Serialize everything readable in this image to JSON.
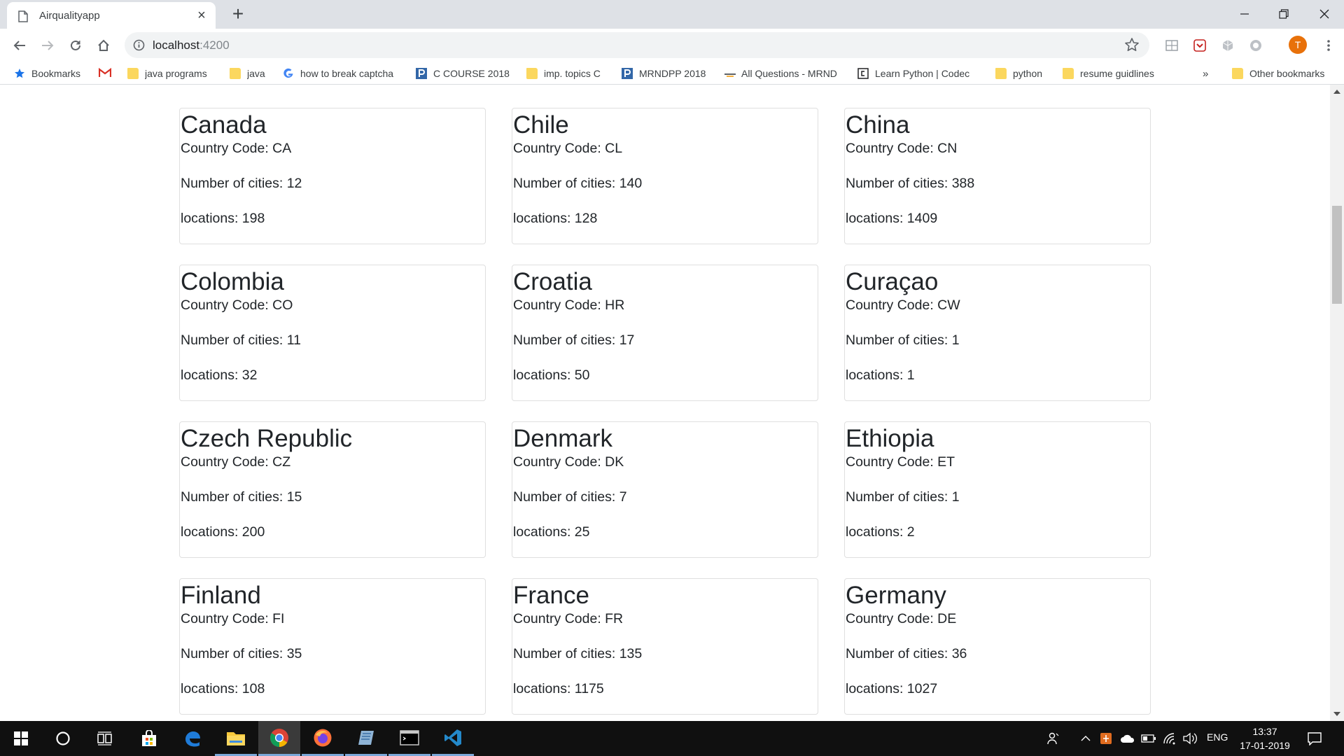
{
  "browser": {
    "tab_title": "Airqualityapp",
    "url_host": "localhost",
    "url_port": ":4200",
    "avatar_initial": "T",
    "accent_color": "#e8710a"
  },
  "bookmarks": {
    "items": [
      {
        "label": "Bookmarks",
        "icon": "star-icon"
      },
      {
        "label": "",
        "icon": "gmail-icon"
      },
      {
        "label": "java programs",
        "icon": "folder-icon"
      },
      {
        "label": "java",
        "icon": "folder-icon"
      },
      {
        "label": "how to break captcha",
        "icon": "google-icon"
      },
      {
        "label": "C COURSE 2018",
        "icon": "p-icon"
      },
      {
        "label": "imp. topics C",
        "icon": "folder-icon"
      },
      {
        "label": "MRNDPP 2018",
        "icon": "p-icon"
      },
      {
        "label": "All Questions - MRND",
        "icon": "dash-icon"
      },
      {
        "label": "Learn Python | Codec",
        "icon": "codec-icon"
      },
      {
        "label": "python",
        "icon": "folder-icon"
      },
      {
        "label": "resume guidlines",
        "icon": "folder-icon"
      }
    ],
    "overflow": "»",
    "other": "Other bookmarks"
  },
  "countries": [
    {
      "name": "Canada",
      "code": "Country Code: CA",
      "cities": "Number of cities: 12",
      "locations": "locations: 198"
    },
    {
      "name": "Chile",
      "code": "Country Code: CL",
      "cities": "Number of cities: 140",
      "locations": "locations: 128"
    },
    {
      "name": "China",
      "code": "Country Code: CN",
      "cities": "Number of cities: 388",
      "locations": "locations: 1409"
    },
    {
      "name": "Colombia",
      "code": "Country Code: CO",
      "cities": "Number of cities: 11",
      "locations": "locations: 32"
    },
    {
      "name": "Croatia",
      "code": "Country Code: HR",
      "cities": "Number of cities: 17",
      "locations": "locations: 50"
    },
    {
      "name": "Curaçao",
      "code": "Country Code: CW",
      "cities": "Number of cities: 1",
      "locations": "locations: 1"
    },
    {
      "name": "Czech Republic",
      "code": "Country Code: CZ",
      "cities": "Number of cities: 15",
      "locations": "locations: 200"
    },
    {
      "name": "Denmark",
      "code": "Country Code: DK",
      "cities": "Number of cities: 7",
      "locations": "locations: 25"
    },
    {
      "name": "Ethiopia",
      "code": "Country Code: ET",
      "cities": "Number of cities: 1",
      "locations": "locations: 2"
    },
    {
      "name": "Finland",
      "code": "Country Code: FI",
      "cities": "Number of cities: 35",
      "locations": "locations: 108"
    },
    {
      "name": "France",
      "code": "Country Code: FR",
      "cities": "Number of cities: 135",
      "locations": "locations: 1175"
    },
    {
      "name": "Germany",
      "code": "Country Code: DE",
      "cities": "Number of cities: 36",
      "locations": "locations: 1027"
    }
  ],
  "taskbar": {
    "apps": [
      "windows-start-icon",
      "cortana-search-icon",
      "task-view-icon",
      "store-icon",
      "edge-icon",
      "file-explorer-icon",
      "chrome-icon",
      "firefox-icon",
      "notepad-icon",
      "terminal-icon",
      "vscode-icon"
    ],
    "active_app": "chrome-icon",
    "language": "ENG",
    "time": "13:37",
    "date": "17-01-2019"
  }
}
